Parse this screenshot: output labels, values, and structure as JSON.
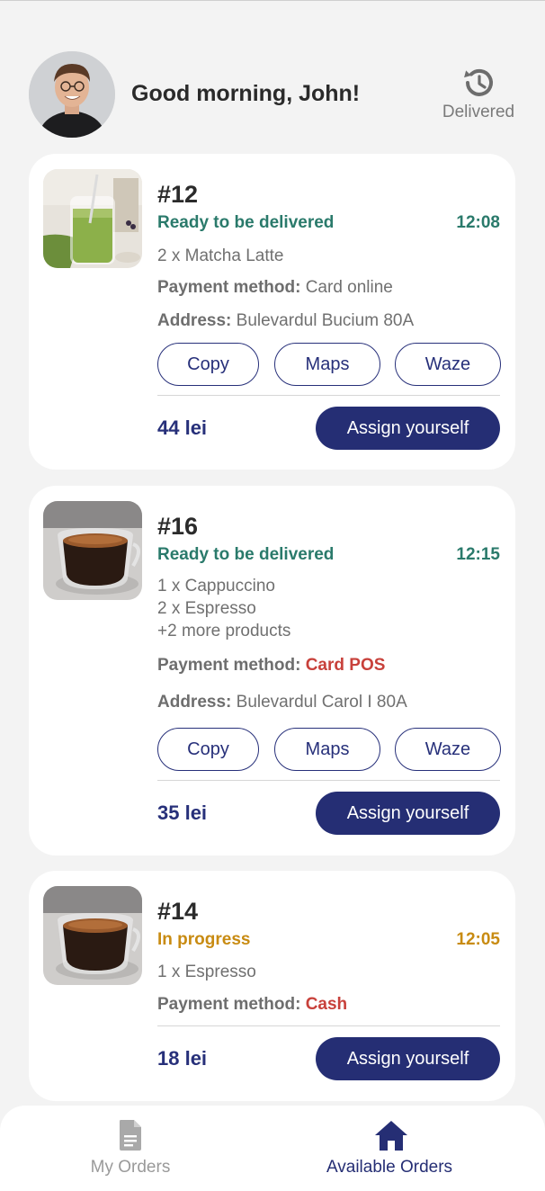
{
  "header": {
    "greeting": "Good morning, John!",
    "delivered_label": "Delivered",
    "delivered_icon": "history-icon",
    "avatar_icon": "user-avatar"
  },
  "buttons": {
    "copy": "Copy",
    "maps": "Maps",
    "waze": "Waze",
    "assign": "Assign yourself"
  },
  "labels": {
    "payment": "Payment method:",
    "address": "Address:"
  },
  "orders": [
    {
      "id": "#12",
      "status": "Ready to be delivered",
      "time": "12:08",
      "items": [
        "2 x Matcha Latte"
      ],
      "payment": "Card online",
      "address": "Bulevardul Bucium 80A",
      "price": "44 lei",
      "image": "matcha-latte-image"
    },
    {
      "id": "#16",
      "status": "Ready to be delivered",
      "time": "12:15",
      "items": [
        "1 x Cappuccino",
        "2 x Espresso",
        "+2 more products"
      ],
      "payment": "Card POS",
      "address": "Bulevardul Carol I 80A",
      "price": "35 lei",
      "image": "espresso-image"
    },
    {
      "id": "#14",
      "status": "In progress",
      "time": "12:05",
      "items": [
        "1 x Espresso"
      ],
      "payment": "Cash",
      "price": "18 lei",
      "image": "espresso-image"
    }
  ],
  "nav": {
    "my_orders": "My Orders",
    "available_orders": "Available Orders"
  },
  "colors": {
    "primary": "#252e74",
    "ready": "#2a7a6b",
    "in_progress": "#c88b12",
    "warning_red": "#c8413b"
  }
}
